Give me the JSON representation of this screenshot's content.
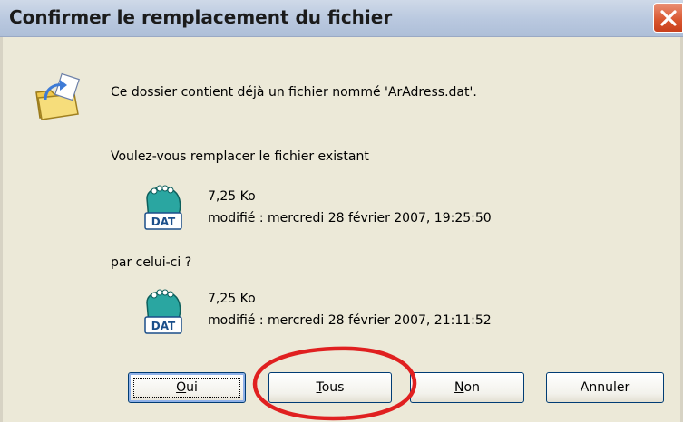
{
  "window": {
    "title": "Confirmer le remplacement du fichier",
    "close_icon": "close-x-icon",
    "accent": "#d8552e"
  },
  "message": {
    "line1": "Ce dossier contient déjà un fichier nommé 'ArAdress.dat'.",
    "line2": "Voulez-vous remplacer le fichier existant",
    "by_label": "par celui-ci ?"
  },
  "existing_file": {
    "icon": "dat-file-icon",
    "icon_text": "DAT",
    "size": "7,25 Ko",
    "modified": "modifié : mercredi 28 février 2007, 19:25:50"
  },
  "new_file": {
    "icon": "dat-file-icon",
    "icon_text": "DAT",
    "size": "7,25 Ko",
    "modified": "modifié : mercredi 28 février 2007, 21:11:52"
  },
  "buttons": {
    "oui_first": "O",
    "oui_rest": "ui",
    "tous_first": "T",
    "tous_rest": "ous",
    "non_first": "N",
    "non_rest": "on",
    "annuler": "Annuler"
  },
  "annotation": {
    "shape": "ellipse",
    "color": "#e02020"
  }
}
